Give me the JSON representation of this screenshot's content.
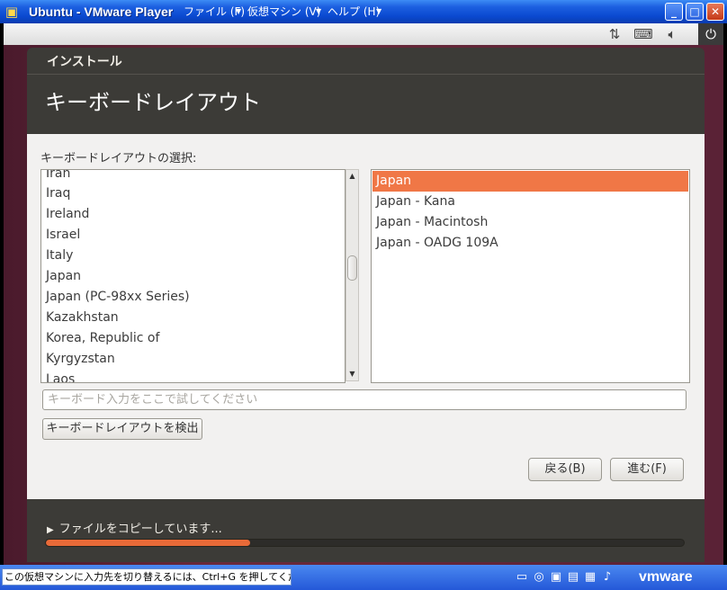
{
  "window": {
    "title": "Ubuntu - VMware Player",
    "menu": [
      "ファイル (F)",
      "仮想マシン (V)",
      "ヘルプ (H)"
    ],
    "controls": {
      "minimize": "_",
      "maximize": "□",
      "close": "✕"
    }
  },
  "toolbar": {
    "icons": [
      "network-icon",
      "keyboard-icon",
      "volume-icon",
      "power-icon"
    ]
  },
  "installer": {
    "header_title": "インストール",
    "page_title": "キーボードレイアウト",
    "select_label": "キーボードレイアウトの選択:",
    "countries": [
      "Iran",
      "Iraq",
      "Ireland",
      "Israel",
      "Italy",
      "Japan",
      "Japan (PC-98xx Series)",
      "Kazakhstan",
      "Korea, Republic of",
      "Kyrgyzstan",
      "Laos"
    ],
    "variants": [
      "Japan",
      "Japan - Kana",
      "Japan - Macintosh",
      "Japan - OADG 109A"
    ],
    "selected_variant_index": 0,
    "test_placeholder": "キーボード入力をここで試してください",
    "detect_button": "キーボードレイアウトを検出",
    "back_button": "戻る(B)",
    "forward_button": "進む(F)",
    "progress_text": "ファイルをコピーしています...",
    "progress_arrow": "▶",
    "progress_fraction": 0.32,
    "accent_color": "#f07746"
  },
  "statusbar": {
    "message": "この仮想マシンに入力先を切り替えるには、Ctrl+G を押してください。",
    "brand": "vmware"
  }
}
